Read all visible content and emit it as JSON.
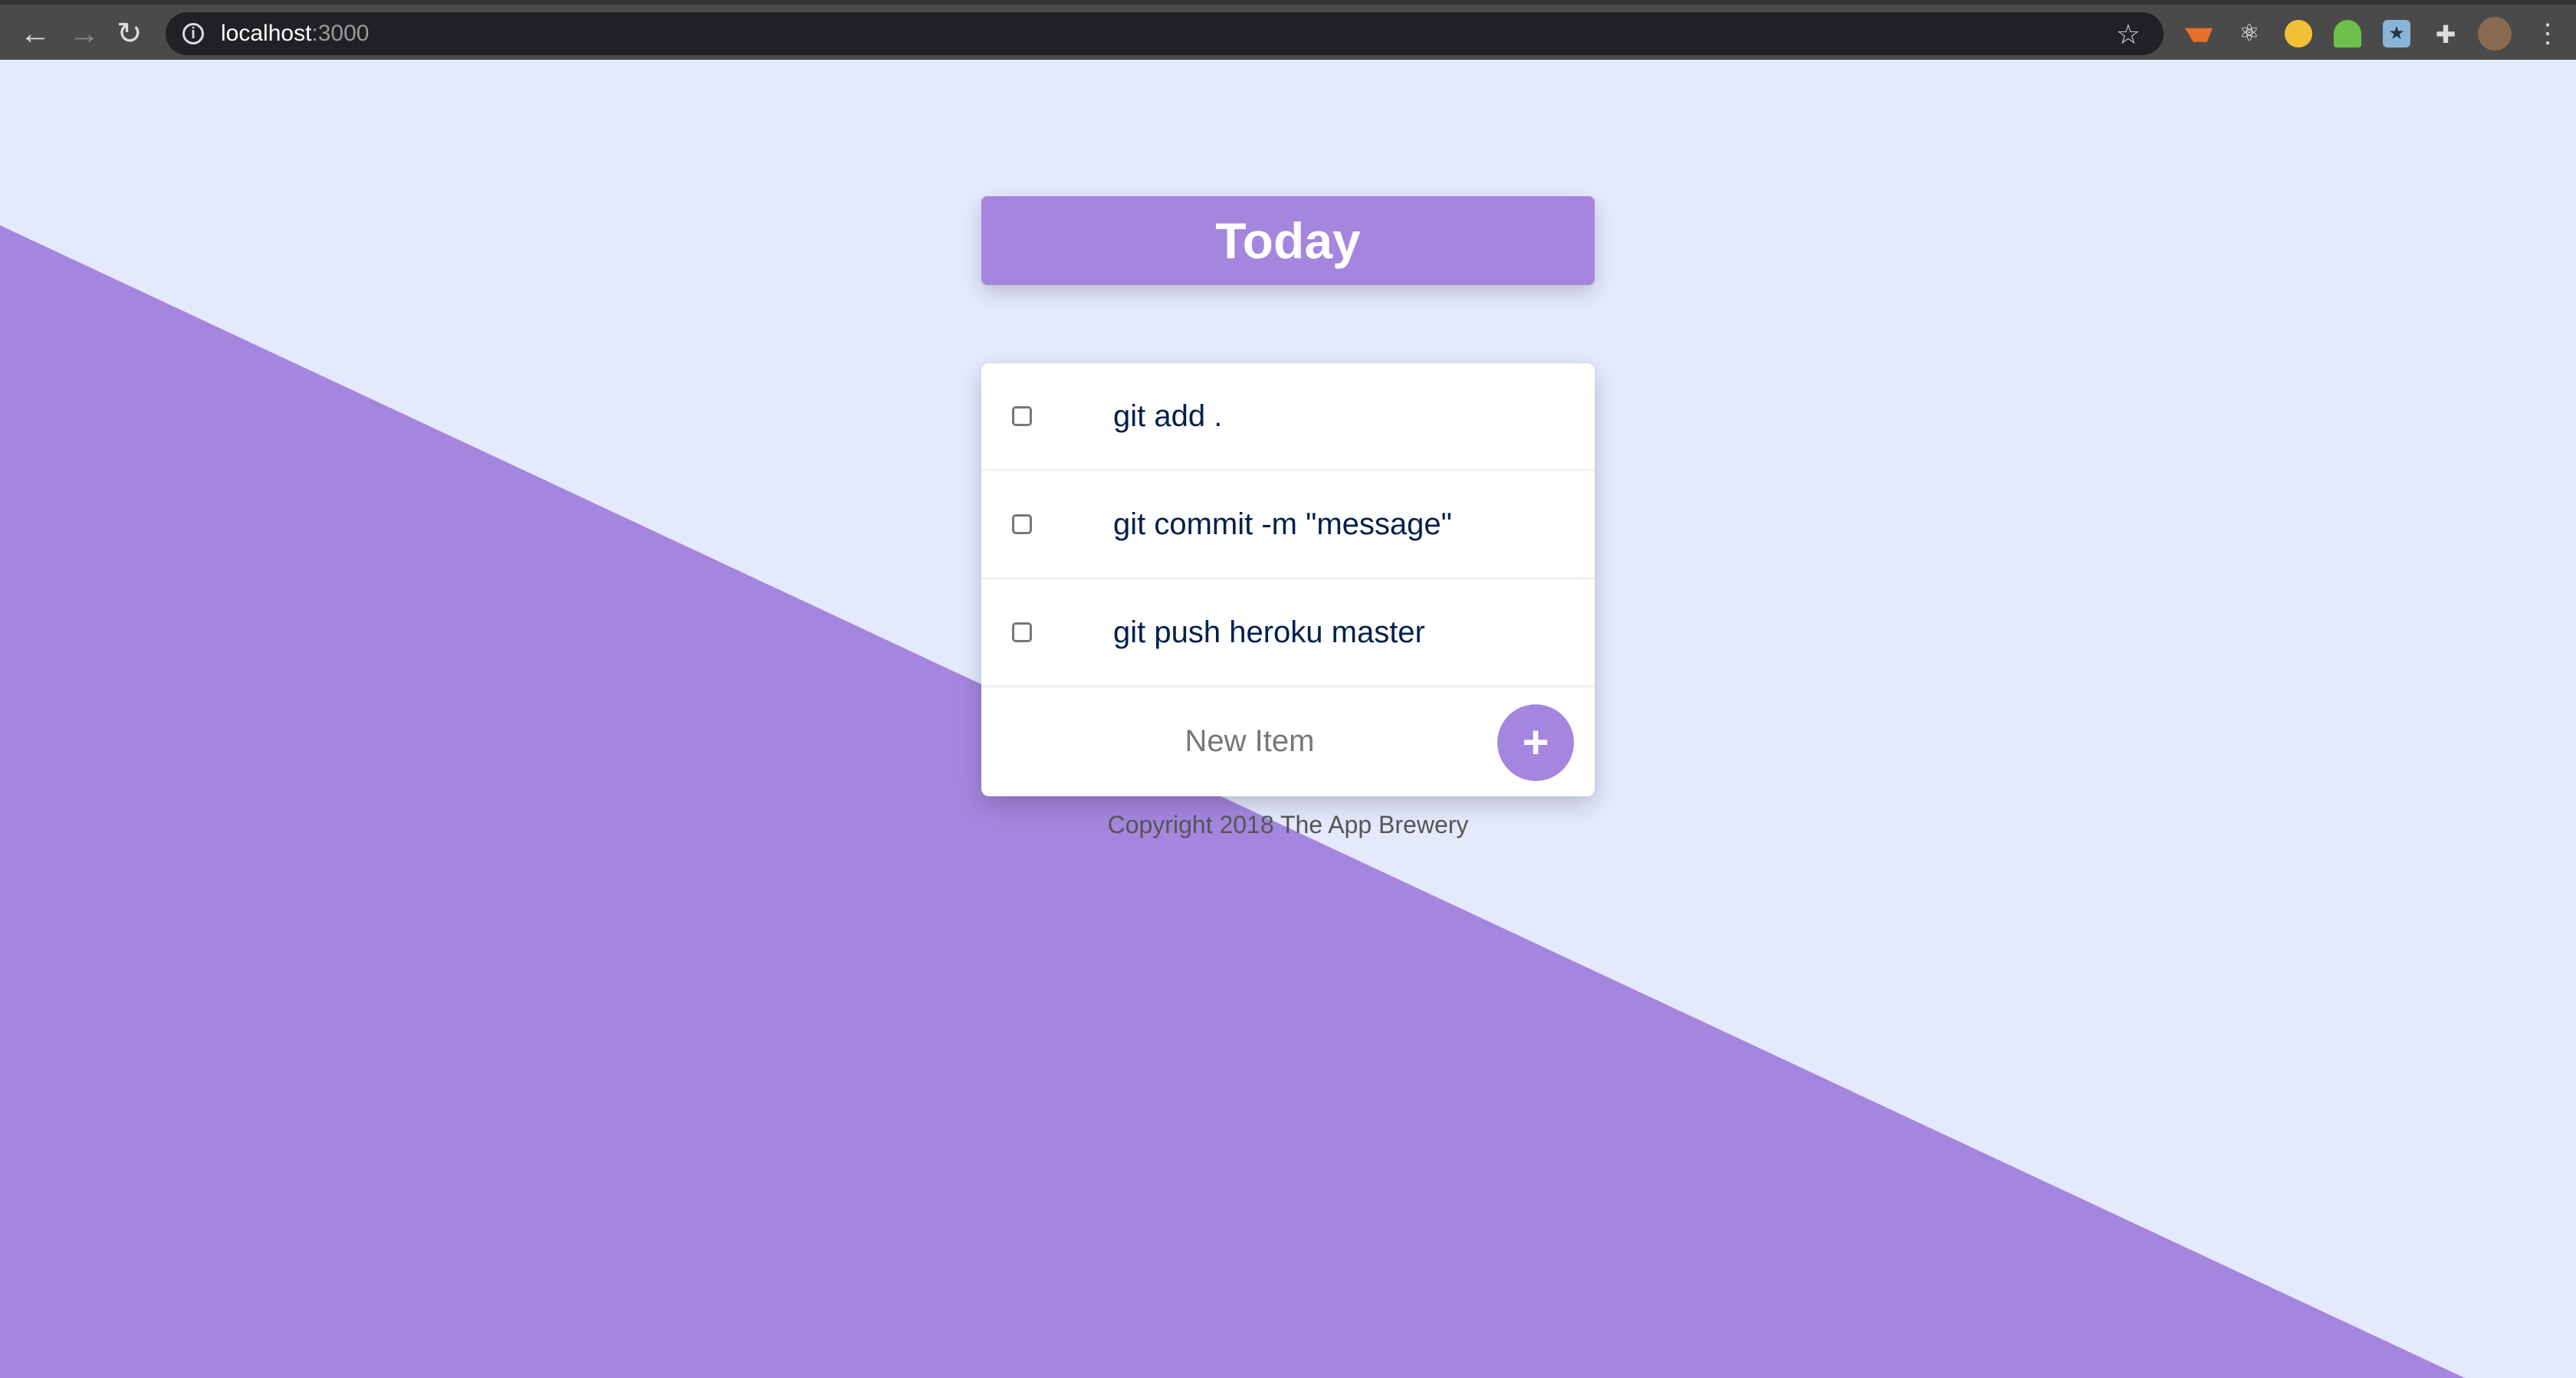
{
  "browser": {
    "host": "localhost",
    "port": ":3000"
  },
  "colors": {
    "accent": "#A486DE",
    "background": "#E4E9FD",
    "text": "#00204A"
  },
  "header": {
    "title": "Today"
  },
  "items": [
    {
      "label": "git add .",
      "checked": false
    },
    {
      "label": "git commit -m \"message\"",
      "checked": false
    },
    {
      "label": "git push heroku master",
      "checked": false
    }
  ],
  "new_item": {
    "placeholder": "New Item",
    "button": "+"
  },
  "footer": {
    "text": "Copyright 2018 The App Brewery"
  }
}
